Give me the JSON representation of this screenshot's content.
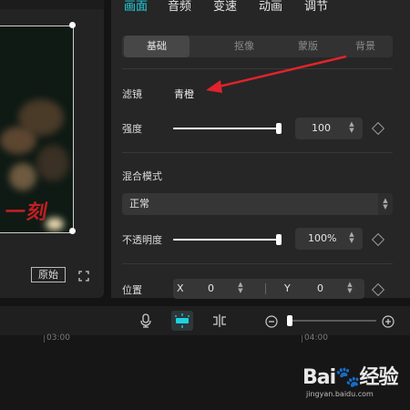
{
  "panel": {
    "tabs": [
      {
        "label": "画面",
        "active": true
      },
      {
        "label": "音频",
        "active": false
      },
      {
        "label": "变速",
        "active": false
      },
      {
        "label": "动画",
        "active": false
      },
      {
        "label": "调节",
        "active": false
      }
    ],
    "subtabs": [
      {
        "label": "基础",
        "active": true
      },
      {
        "label": "抠像",
        "active": false
      },
      {
        "label": "蒙版",
        "active": false
      },
      {
        "label": "背景",
        "active": false
      }
    ],
    "filter": {
      "label": "滤镜",
      "value": "青橙"
    },
    "strength": {
      "label": "强度",
      "value": "100",
      "level": 1.0
    },
    "blend": {
      "section_label": "混合模式",
      "mode": "正常"
    },
    "opacity": {
      "label": "不透明度",
      "value": "100%",
      "level": 1.0
    },
    "position": {
      "label": "位置",
      "x_label": "X",
      "x_value": "0",
      "y_label": "Y",
      "y_value": "0"
    }
  },
  "preview": {
    "original_label": "原始",
    "video_text": "一刻"
  },
  "timeline": {
    "ticks": [
      "03:00",
      "04:00"
    ],
    "zoom_level": 0.05
  },
  "watermark": {
    "brand": "Bai🐾经验",
    "url": "jingyan.baidu.com"
  },
  "colors": {
    "accent": "#1fd1e0",
    "annotation_arrow": "#e0232c",
    "panel_bg": "#262626"
  }
}
